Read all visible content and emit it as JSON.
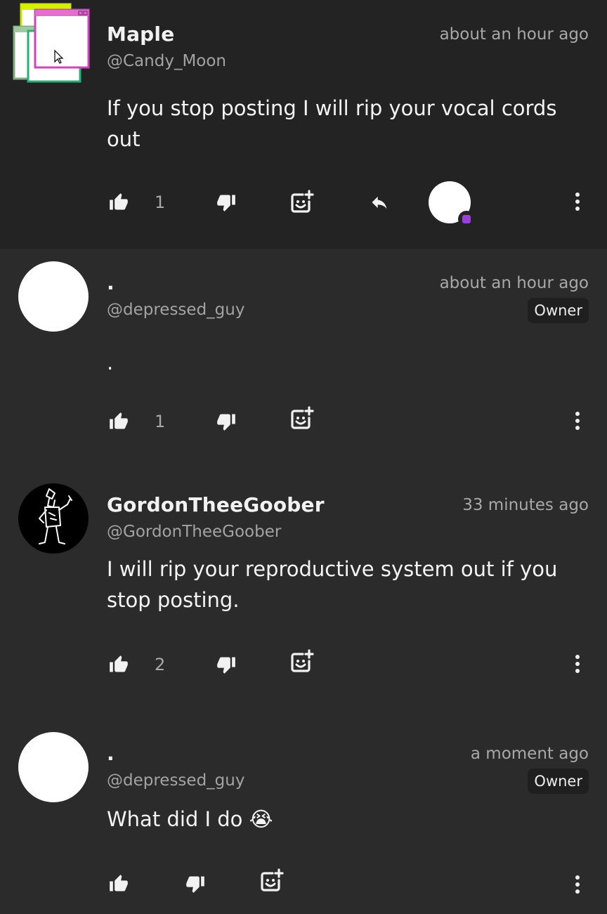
{
  "comments": [
    {
      "author": "Maple",
      "handle": "@Candy_Moon",
      "time": "about an hour ago",
      "text": "If you stop posting I will rip your vocal cords out",
      "likes": "1",
      "owner_badge": "",
      "avatar": "retro-windows-avatar"
    },
    {
      "author": ".",
      "handle": "@depressed_guy",
      "time": "about an hour ago",
      "text": ".",
      "likes": "1",
      "owner_badge": "Owner",
      "avatar": "white-circle-avatar"
    },
    {
      "author": "GordonTheeGoober",
      "handle": "@GordonTheeGoober",
      "time": "33 minutes ago",
      "text": "I will rip your reproductive system out if you stop posting.",
      "likes": "2",
      "owner_badge": "",
      "avatar": "gordon-drawing-avatar"
    },
    {
      "author": ".",
      "handle": "@depressed_guy",
      "time": "a moment ago",
      "text": "What did I do 😭",
      "likes": "",
      "owner_badge": "Owner",
      "avatar": "white-circle-avatar"
    }
  ],
  "icons": {
    "like": "thumbs-up-icon",
    "dislike": "thumbs-down-icon",
    "react": "add-reaction-icon",
    "reply": "reply-arrow-icon",
    "more": "more-vertical-icon",
    "creator_heart": "creator-heart-badge"
  },
  "colors": {
    "background": "#2b2b2b",
    "highlighted_background": "#232323",
    "accent": "#9b3fe0"
  }
}
